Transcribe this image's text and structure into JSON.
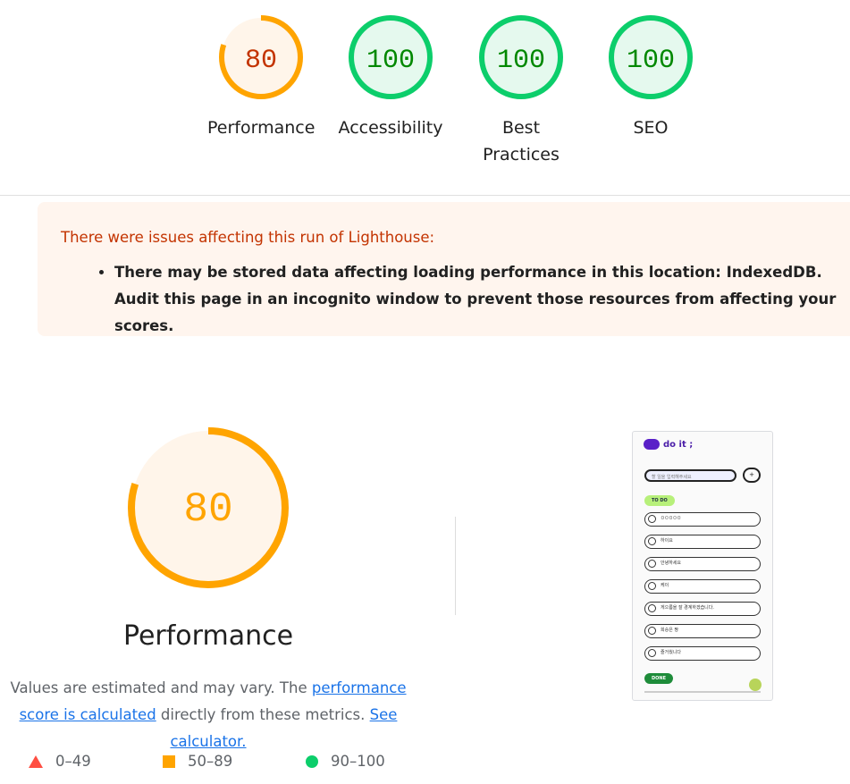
{
  "categories": [
    {
      "label": "80",
      "name": "Performance",
      "score": 80,
      "status": "average"
    },
    {
      "label": "100",
      "name": "Accessibility",
      "score": 100,
      "status": "pass"
    },
    {
      "label": "100",
      "name": "Best\nPractices",
      "score": 100,
      "status": "pass"
    },
    {
      "label": "100",
      "name": "SEO",
      "score": 100,
      "status": "pass"
    }
  ],
  "colors": {
    "pass": "#0cce6b",
    "pass_bg": "#e5f9ee",
    "pass_text": "#008800",
    "average": "#ffa400",
    "average_bg": "#fff5ea",
    "average_text": "#c33300",
    "fail": "#ff4e42"
  },
  "warning": {
    "title": "There were issues affecting this run of Lighthouse:",
    "items": [
      "There may be stored data affecting loading performance in this location: IndexedDB. Audit this page in an incognito window to prevent those resources from affecting your scores."
    ]
  },
  "performance": {
    "score_label": "80",
    "score": 80,
    "title": "Performance",
    "desc_prefix": "Values are estimated and may vary. The ",
    "desc_link1": "performance score is calculated",
    "desc_middle": " directly from these metrics.",
    "desc_link2": "See calculator."
  },
  "legend": [
    {
      "icon": "triangle-icon",
      "range": "0–49"
    },
    {
      "icon": "square-icon",
      "range": "50–89"
    },
    {
      "icon": "circle-icon",
      "range": "90–100"
    }
  ],
  "screenshot": {
    "app_title": "do it ;",
    "search_placeholder": "할 일을 입력해주세요",
    "add_label": "+",
    "todo_tag": "TO DO",
    "done_tag": "DONE",
    "todos": [
      "ㅁㅁㅁㅁㅁ",
      "하이요",
      "안녕하세요",
      "케이",
      "게으름을 잘 경계하겠습니다.",
      "희승은 짱",
      "즐거웠니다"
    ]
  }
}
